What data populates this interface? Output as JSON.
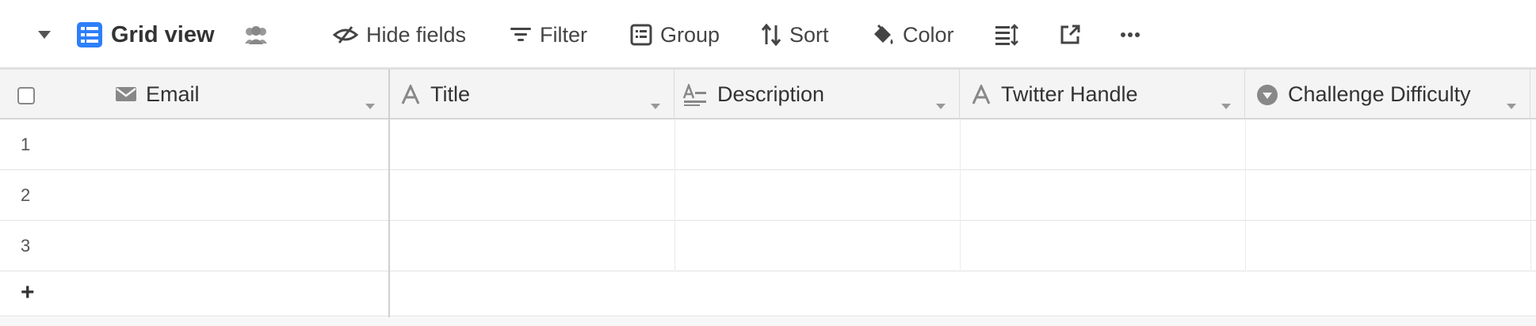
{
  "toolbar": {
    "view_name": "Grid view",
    "hide_fields": "Hide fields",
    "filter": "Filter",
    "group": "Group",
    "sort": "Sort",
    "color": "Color",
    "icons": [
      "caret-down",
      "grid-view",
      "people",
      "eye-slash",
      "filter-lines",
      "group-list",
      "sort-arrows",
      "paint-bucket",
      "row-height",
      "share-external",
      "more-dots"
    ],
    "accent_color": "#2d7ff9"
  },
  "grid": {
    "columns": [
      {
        "name": "Email",
        "icon": "envelope-icon"
      },
      {
        "name": "Title",
        "icon": "text-a-icon"
      },
      {
        "name": "Description",
        "icon": "long-text-icon"
      },
      {
        "name": "Twitter Handle",
        "icon": "text-a-icon"
      },
      {
        "name": "Challenge Difficulty",
        "icon": "single-select-icon"
      }
    ],
    "rows": [
      "1",
      "2",
      "3"
    ],
    "add_row": "+"
  }
}
